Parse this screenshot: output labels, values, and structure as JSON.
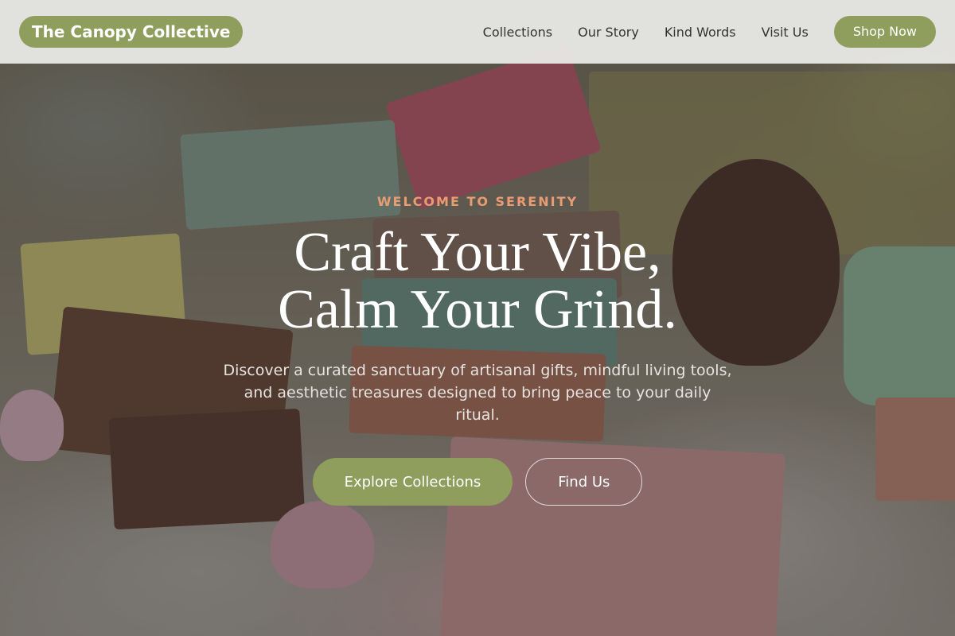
{
  "header": {
    "brand": "The Canopy Collective",
    "nav": [
      {
        "label": "Collections"
      },
      {
        "label": "Our Story"
      },
      {
        "label": "Kind Words"
      },
      {
        "label": "Visit Us"
      }
    ],
    "shop_label": "Shop Now"
  },
  "hero": {
    "eyebrow": "WELCOME TO SERENITY",
    "headline_line1": "Craft Your Vibe,",
    "headline_line2": "Calm Your Grind.",
    "subtext": "Discover a curated sanctuary of artisanal gifts, mindful living tools, and aesthetic treasures designed to bring peace to your daily ritual.",
    "primary_cta": "Explore Collections",
    "secondary_cta": "Find Us"
  },
  "colors": {
    "accent": "#8f9e5c",
    "eyebrow": "#e99b74",
    "header_bg": "#ecece9"
  }
}
